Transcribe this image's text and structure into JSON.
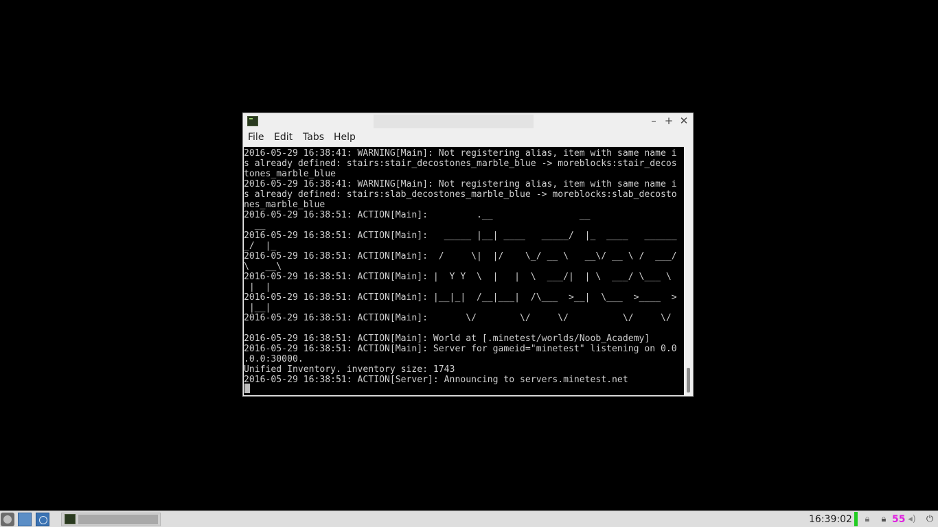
{
  "window": {
    "title": "",
    "controls": {
      "minimize": "–",
      "maximize": "+",
      "close": "✕"
    }
  },
  "menu": {
    "file": "File",
    "edit": "Edit",
    "tabs": "Tabs",
    "help": "Help"
  },
  "terminal": {
    "text": "2016-05-29 16:38:41: WARNING[Main]: Not registering alias, item with same name i\ns already defined: stairs:stair_decostones_marble_blue -> moreblocks:stair_decos\ntones_marble_blue\n2016-05-29 16:38:41: WARNING[Main]: Not registering alias, item with same name i\ns already defined: stairs:slab_decostones_marble_blue -> moreblocks:slab_decosto\nnes_marble_blue\n2016-05-29 16:38:51: ACTION[Main]:         .__                __\n  __\n2016-05-29 16:38:51: ACTION[Main]:   _____ |__| ____   _____/  |_  ____   ______\n_/  |_\n2016-05-29 16:38:51: ACTION[Main]:  /     \\|  |/    \\_/ __ \\   __\\/ __ \\ /  ___/\n\\   __\\\n2016-05-29 16:38:51: ACTION[Main]: |  Y Y  \\  |   |  \\  ___/|  | \\  ___/ \\___ \\\n |  |\n2016-05-29 16:38:51: ACTION[Main]: |__|_|  /__|___|  /\\___  >__|  \\___  >____  >\n |__|\n2016-05-29 16:38:51: ACTION[Main]:       \\/        \\/     \\/          \\/     \\/\n\n2016-05-29 16:38:51: ACTION[Main]: World at [.minetest/worlds/Noob_Academy]\n2016-05-29 16:38:51: ACTION[Main]: Server for gameid=\"minetest\" listening on 0.0\n.0.0:30000.\nUnified Inventory. inventory size: 1743\n2016-05-29 16:38:51: ACTION[Server]: Announcing to servers.minetest.net"
  },
  "taskbar": {
    "task_label": "",
    "clock": "16:39:02",
    "counter": "55",
    "colors": {
      "battery": "#22cc22",
      "counter": "#e020e0"
    },
    "icons": [
      "start-menu-icon",
      "file-manager-icon",
      "browser-icon",
      "terminal-icon",
      "lock-icon",
      "lock-icon",
      "volume-icon",
      "power-icon"
    ]
  }
}
